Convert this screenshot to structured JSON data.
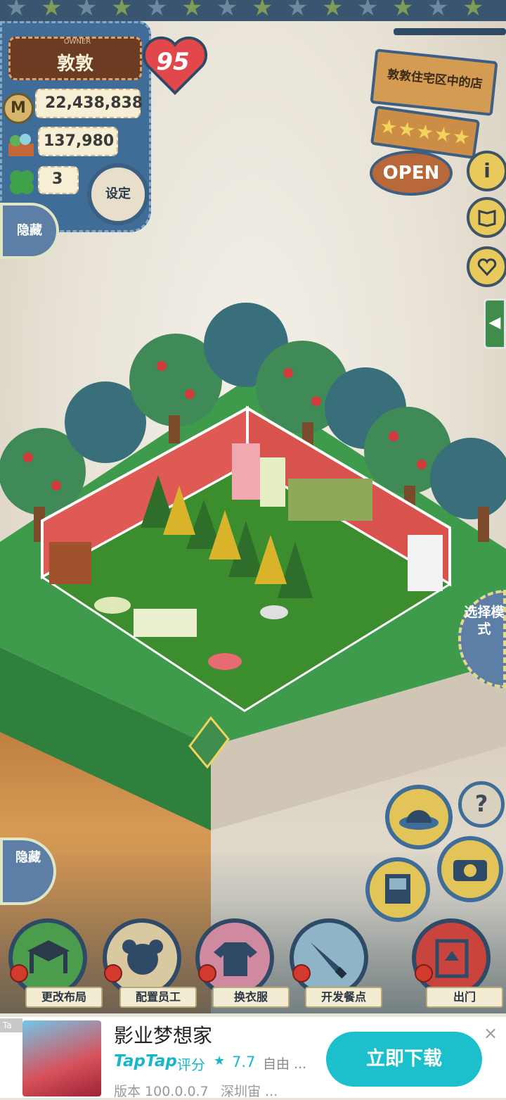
{
  "hud": {
    "owner_caption": "OWNER",
    "owner_name": "敦敦",
    "level": "95",
    "money": "22,438,838",
    "food": "137,980",
    "clover": "3",
    "coin_symbol": "M",
    "settings_label": "设定",
    "hide_top_label": "隐藏"
  },
  "shop_sign": {
    "name": "敦敦住宅区中的店",
    "rating_stars": "★★★★★",
    "open_label": "OPEN"
  },
  "side_buttons": {
    "info_icon": "i",
    "book_icon": "book-icon",
    "heart_icon": "heart-icon"
  },
  "select_mode_label": "选择模式",
  "right_buttons": {
    "help_label": "?"
  },
  "hide_bottom_label": "隐藏",
  "bottom_menu": [
    {
      "label": "更改布局",
      "color": "#4c9c4e"
    },
    {
      "label": "配置员工",
      "color": "#d9c9a0"
    },
    {
      "label": "换衣服",
      "color": "#d08aa0"
    },
    {
      "label": "开发餐点",
      "color": "#8fb4c7"
    },
    {
      "label": "出门",
      "color": "#c9443c"
    }
  ],
  "ad": {
    "corner": "Ta",
    "title": "影业梦想家",
    "brand": "TapTap",
    "rating_label": "评分",
    "star": "★",
    "score": "7.7",
    "tag": "自由 ...",
    "version": "版本 100.0.0.7",
    "developer": "深圳宙 ...",
    "download_label": "立即下载",
    "close": "×"
  },
  "colors": {
    "panel_blue": "#3f6d98",
    "grass": "#3f9a4a",
    "room_wall": "#e05a55",
    "accent_cyan": "#1cbfcc"
  }
}
